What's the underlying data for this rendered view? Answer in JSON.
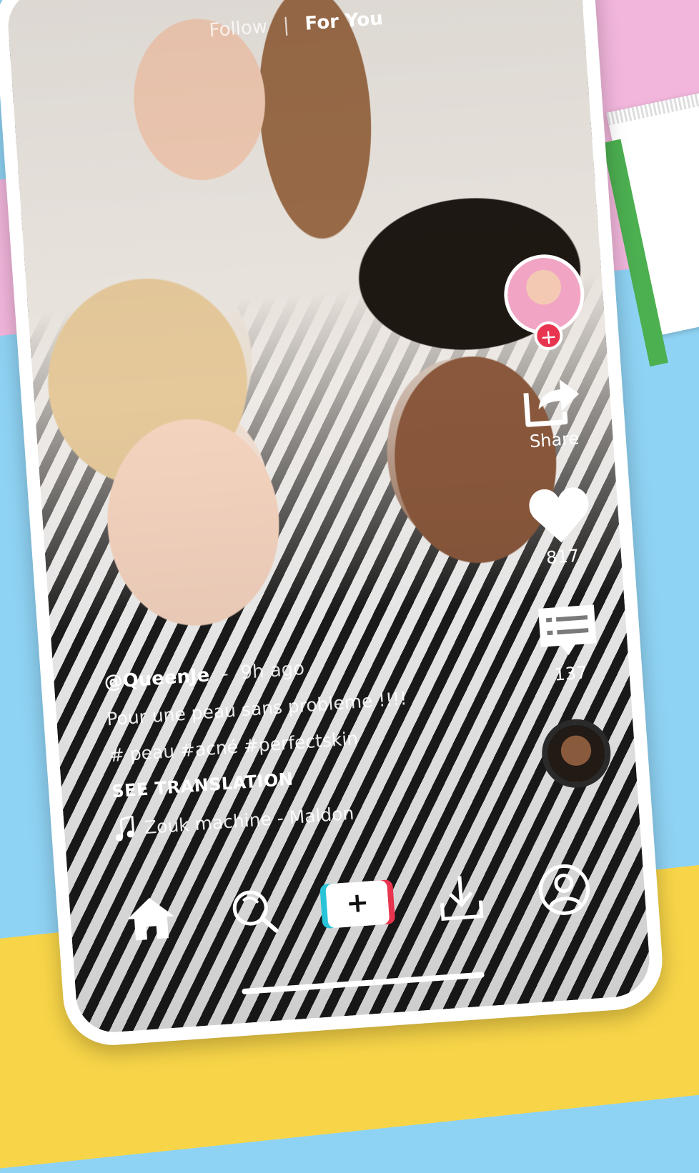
{
  "top_tabs": {
    "follow": "Follow",
    "separator": "|",
    "for_you": "For You"
  },
  "right_rail": {
    "share_label": "Share",
    "like_count": "817",
    "comment_count": "137",
    "follow_symbol": "+"
  },
  "caption": {
    "username": "@QueenJe",
    "time_sep": "-",
    "time": "9h ago",
    "text": "Pour une peau sans probleme !!!!",
    "hashtags": "# peau #acné #perfectskin",
    "see_translation": "SEE TRANSLATION",
    "music": "Zouk machine - Maldon"
  },
  "bottom_nav": {
    "create_symbol": "+"
  },
  "icons": {
    "share": "share-arrow-icon",
    "like": "heart-icon",
    "comment": "comment-bubble-icon",
    "home": "home-icon",
    "search": "search-icon",
    "download": "download-icon",
    "profile": "profile-icon",
    "music": "music-note-icon"
  },
  "colors": {
    "accent_red": "#e8344e",
    "accent_cyan": "#29c4d8",
    "bg_blue": "#8fd3f4",
    "bg_pink": "#f2b6dc",
    "bg_yellow": "#f8d548"
  }
}
